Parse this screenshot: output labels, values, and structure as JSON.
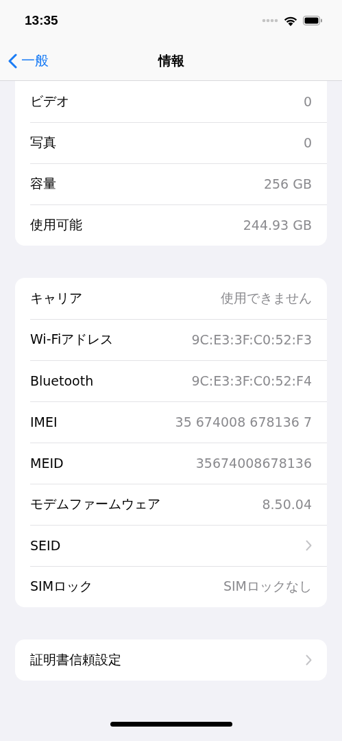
{
  "status_bar": {
    "time": "13:35"
  },
  "nav": {
    "back_label": "一般",
    "title": "情報"
  },
  "groups": [
    {
      "cut_top": true,
      "rows": [
        {
          "kind": "value",
          "label": "ビデオ",
          "value": "0"
        },
        {
          "kind": "value",
          "label": "写真",
          "value": "0"
        },
        {
          "kind": "value",
          "label": "容量",
          "value": "256 GB"
        },
        {
          "kind": "value",
          "label": "使用可能",
          "value": "244.93 GB"
        }
      ]
    },
    {
      "cut_top": false,
      "rows": [
        {
          "kind": "value",
          "label": "キャリア",
          "value": "使用できません"
        },
        {
          "kind": "value",
          "label": "Wi-Fiアドレス",
          "value": "9C:E3:3F:C0:52:F3"
        },
        {
          "kind": "value",
          "label": "Bluetooth",
          "value": "9C:E3:3F:C0:52:F4"
        },
        {
          "kind": "value",
          "label": "IMEI",
          "value": "35 674008 678136 7"
        },
        {
          "kind": "value",
          "label": "MEID",
          "value": "35674008678136"
        },
        {
          "kind": "value",
          "label": "モデムファームウェア",
          "value": "8.50.04"
        },
        {
          "kind": "disclosure",
          "label": "SEID"
        },
        {
          "kind": "value",
          "label": "SIMロック",
          "value": "SIMロックなし"
        }
      ]
    },
    {
      "cut_top": false,
      "rows": [
        {
          "kind": "disclosure",
          "label": "証明書信頼設定"
        }
      ]
    }
  ]
}
